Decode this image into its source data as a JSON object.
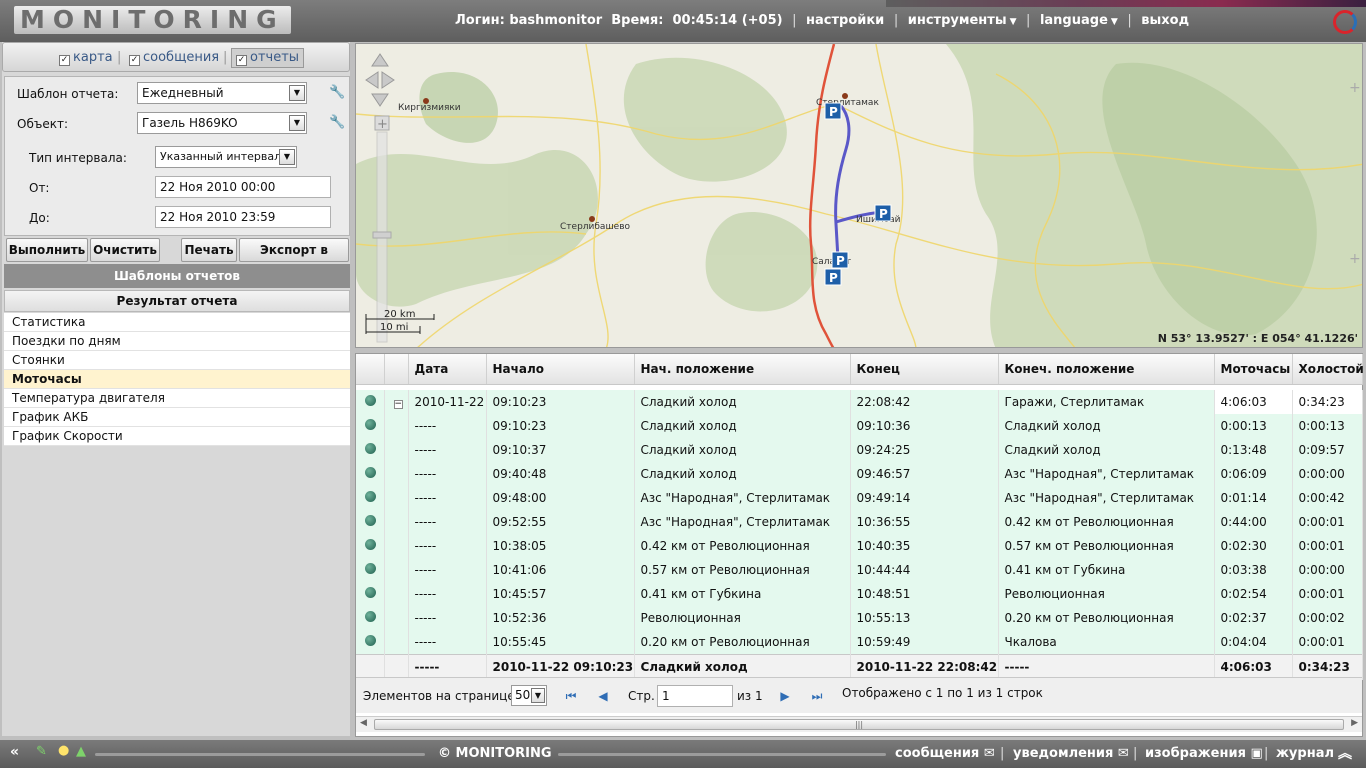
{
  "header": {
    "logo": "MONITORING",
    "login_label": "Логин:",
    "login_value": "bashmonitor",
    "time_label": "Время:",
    "time_value": "00:45:14 (+05)",
    "settings": "настройки",
    "tools": "инструменты",
    "language": "language",
    "logout": "выход"
  },
  "toggles": {
    "map": "карта",
    "messages": "сообщения",
    "reports": "отчеты"
  },
  "form": {
    "template_label": "Шаблон отчета:",
    "template_value": "Ежедневный",
    "object_label": "Объект:",
    "object_value": "Газель H869KO",
    "interval_label": "Тип интервала:",
    "interval_value": "Указанный интервал",
    "from_label": "От:",
    "from_value": "22 Ноя 2010 00:00",
    "to_label": "До:",
    "to_value": "22 Ноя 2010 23:59"
  },
  "buttons": {
    "execute": "Выполнить",
    "clear": "Очистить",
    "print": "Печать",
    "export": "Экспорт в файл"
  },
  "templates_header": "Шаблоны отчетов",
  "result_header": "Результат отчета",
  "result_items": [
    {
      "label": "Статистика"
    },
    {
      "label": "Поездки по дням"
    },
    {
      "label": "Стоянки"
    },
    {
      "label": "Моточасы"
    },
    {
      "label": "Температура двигателя"
    },
    {
      "label": "График АКБ"
    },
    {
      "label": "График Скорости"
    }
  ],
  "map": {
    "cities": [
      "Стерлитамак",
      "Киргизмияки",
      "Стерлибашево",
      "Ишимбай",
      "Салават"
    ],
    "scale_km": "20 km",
    "scale_mi": "10 mi",
    "coords": "N 53° 13.9527' : E 054° 41.1226'"
  },
  "table": {
    "columns": [
      "Дата",
      "Начало",
      "Нач. положение",
      "Конец",
      "Конеч. положение",
      "Моточасы",
      "Холостой"
    ],
    "rows": [
      {
        "date": "2010-11-22",
        "start": "09:10:23",
        "start_pos": "Сладкий холод",
        "end": "22:08:42",
        "end_pos": "Гаражи, Стерлитамак",
        "hours": "4:06:03",
        "idle": "0:34:23"
      },
      {
        "date": "-----",
        "start": "09:10:23",
        "start_pos": "Сладкий холод",
        "end": "09:10:36",
        "end_pos": "Сладкий холод",
        "hours": "0:00:13",
        "idle": "0:00:13"
      },
      {
        "date": "-----",
        "start": "09:10:37",
        "start_pos": "Сладкий холод",
        "end": "09:24:25",
        "end_pos": "Сладкий холод",
        "hours": "0:13:48",
        "idle": "0:09:57"
      },
      {
        "date": "-----",
        "start": "09:40:48",
        "start_pos": "Сладкий холод",
        "end": "09:46:57",
        "end_pos": "Азс \"Народная\", Стерлитамак",
        "hours": "0:06:09",
        "idle": "0:00:00"
      },
      {
        "date": "-----",
        "start": "09:48:00",
        "start_pos": "Азс \"Народная\", Стерлитамак",
        "end": "09:49:14",
        "end_pos": "Азс \"Народная\", Стерлитамак",
        "hours": "0:01:14",
        "idle": "0:00:42"
      },
      {
        "date": "-----",
        "start": "09:52:55",
        "start_pos": "Азс \"Народная\", Стерлитамак",
        "end": "10:36:55",
        "end_pos": "0.42 км от Революционная",
        "hours": "0:44:00",
        "idle": "0:00:01"
      },
      {
        "date": "-----",
        "start": "10:38:05",
        "start_pos": "0.42 км от Революционная",
        "end": "10:40:35",
        "end_pos": "0.57 км от Революционная",
        "hours": "0:02:30",
        "idle": "0:00:01"
      },
      {
        "date": "-----",
        "start": "10:41:06",
        "start_pos": "0.57 км от Революционная",
        "end": "10:44:44",
        "end_pos": "0.41 км от Губкина",
        "hours": "0:03:38",
        "idle": "0:00:00"
      },
      {
        "date": "-----",
        "start": "10:45:57",
        "start_pos": "0.41 км от Губкина",
        "end": "10:48:51",
        "end_pos": "Революционная",
        "hours": "0:02:54",
        "idle": "0:00:01"
      },
      {
        "date": "-----",
        "start": "10:52:36",
        "start_pos": "Революционная",
        "end": "10:55:13",
        "end_pos": "0.20 км от Революционная",
        "hours": "0:02:37",
        "idle": "0:00:02"
      },
      {
        "date": "-----",
        "start": "10:55:45",
        "start_pos": "0.20 км от Революционная",
        "end": "10:59:49",
        "end_pos": "Чкалова",
        "hours": "0:04:04",
        "idle": "0:00:01"
      }
    ],
    "total": {
      "date": "-----",
      "start": "2010-11-22 09:10:23",
      "start_pos": "Сладкий холод",
      "end": "2010-11-22 22:08:42",
      "end_pos": "-----",
      "hours": "4:06:03",
      "idle": "0:34:23"
    }
  },
  "pager": {
    "per_page_label": "Элементов на странице:",
    "per_page_value": "50",
    "page_label": "Стр.",
    "page_value": "1",
    "of_label": "из 1",
    "summary": "Отображено с 1 по 1 из 1 строк"
  },
  "footer": {
    "copyright": "© MONITORING",
    "messages": "сообщения",
    "notifications": "уведомления",
    "images": "изображения",
    "journal": "журнал"
  },
  "colors": {
    "track": "#5a58c8",
    "road": "#e0533a",
    "row": "#e4f9ee",
    "active_item": "#fff3cf"
  }
}
